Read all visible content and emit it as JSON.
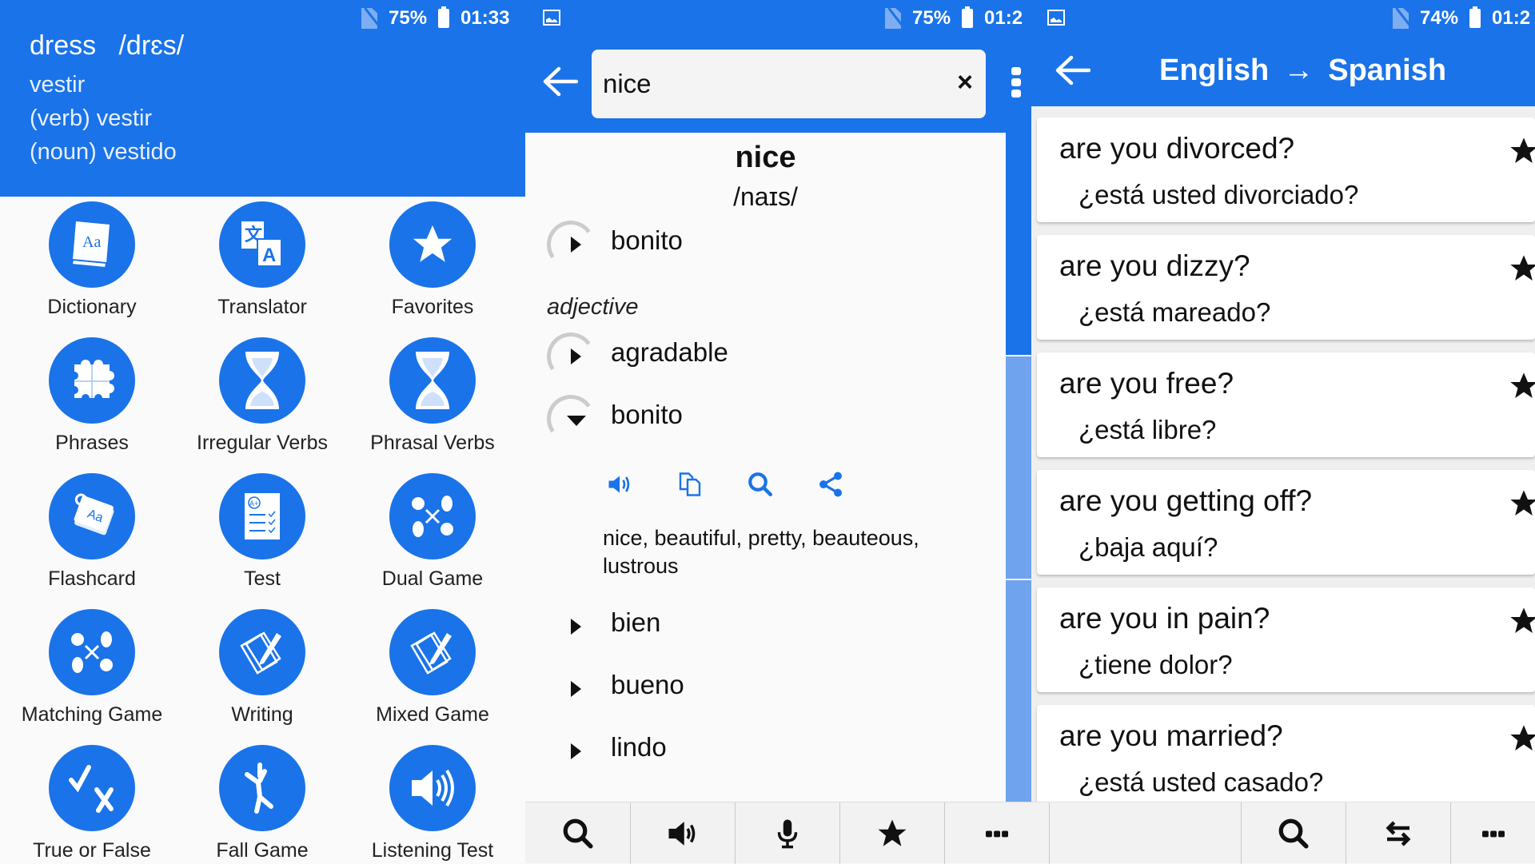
{
  "screens": {
    "left": {
      "status": {
        "battery": "75%",
        "time": "01:33"
      },
      "header": {
        "word": "dress",
        "pronunciation": "/drɛs/",
        "lines": [
          "vestir",
          "(verb) vestir",
          "(noun) vestido"
        ]
      },
      "menu": [
        {
          "label": "Dictionary",
          "icon": "dictionary-book-icon"
        },
        {
          "label": "Translator",
          "icon": "translate-icon"
        },
        {
          "label": "Favorites",
          "icon": "star-icon"
        },
        {
          "label": "Phrases",
          "icon": "puzzle-icon"
        },
        {
          "label": "Irregular Verbs",
          "icon": "hourglass-icon"
        },
        {
          "label": "Phrasal Verbs",
          "icon": "hourglass-icon"
        },
        {
          "label": "Flashcard",
          "icon": "flashcard-icon"
        },
        {
          "label": "Test",
          "icon": "test-sheet-icon"
        },
        {
          "label": "Dual Game",
          "icon": "fruit-match-icon"
        },
        {
          "label": "Matching Game",
          "icon": "fruit-match-icon"
        },
        {
          "label": "Writing",
          "icon": "writing-pencil-icon"
        },
        {
          "label": "Mixed Game",
          "icon": "writing-pencil-icon"
        },
        {
          "label": "True or False",
          "icon": "check-cross-icon"
        },
        {
          "label": "Fall Game",
          "icon": "falling-person-icon"
        },
        {
          "label": "Listening Test",
          "icon": "speaker-icon"
        }
      ]
    },
    "middle": {
      "status": {
        "battery": "75%",
        "time": "01:2"
      },
      "search": {
        "value": "nice",
        "clear_label": "×"
      },
      "headword": "nice",
      "pronunciation": "/naɪs/",
      "first_entry": "bonito",
      "part_of_speech": "adjective",
      "entries": [
        {
          "word": "agradable",
          "expanded": false
        },
        {
          "word": "bonito",
          "expanded": true
        },
        {
          "word": "bien",
          "expanded": false
        },
        {
          "word": "bueno",
          "expanded": false
        },
        {
          "word": "lindo",
          "expanded": false
        }
      ],
      "expanded_synonyms": "nice, beautiful, pretty, beauteous, lustrous",
      "actions": [
        "speak",
        "copy",
        "search",
        "share"
      ]
    },
    "right": {
      "status": {
        "battery": "74%",
        "time": "01:2"
      },
      "title": {
        "from": "English",
        "arrow": "→",
        "to": "Spanish"
      },
      "phrases": [
        {
          "en": "are you divorced?",
          "es": "¿está usted divorciado?",
          "favorite": true
        },
        {
          "en": "are you dizzy?",
          "es": "¿está mareado?",
          "favorite": true
        },
        {
          "en": "are you free?",
          "es": "¿está libre?",
          "favorite": true
        },
        {
          "en": "are you getting off?",
          "es": "¿baja aquí?",
          "favorite": true
        },
        {
          "en": "are you in pain?",
          "es": "¿tiene dolor?",
          "favorite": true
        },
        {
          "en": "are you married?",
          "es": "¿está usted casado?",
          "favorite": true
        }
      ]
    }
  },
  "bottom_bar": {
    "middle": [
      "search",
      "speaker",
      "microphone",
      "favorites",
      "more"
    ],
    "right": [
      "search",
      "swap-languages",
      "more"
    ]
  },
  "colors": {
    "primary": "#1a73e8",
    "primary_light": "#6fa3ed",
    "background": "#fafafa"
  }
}
